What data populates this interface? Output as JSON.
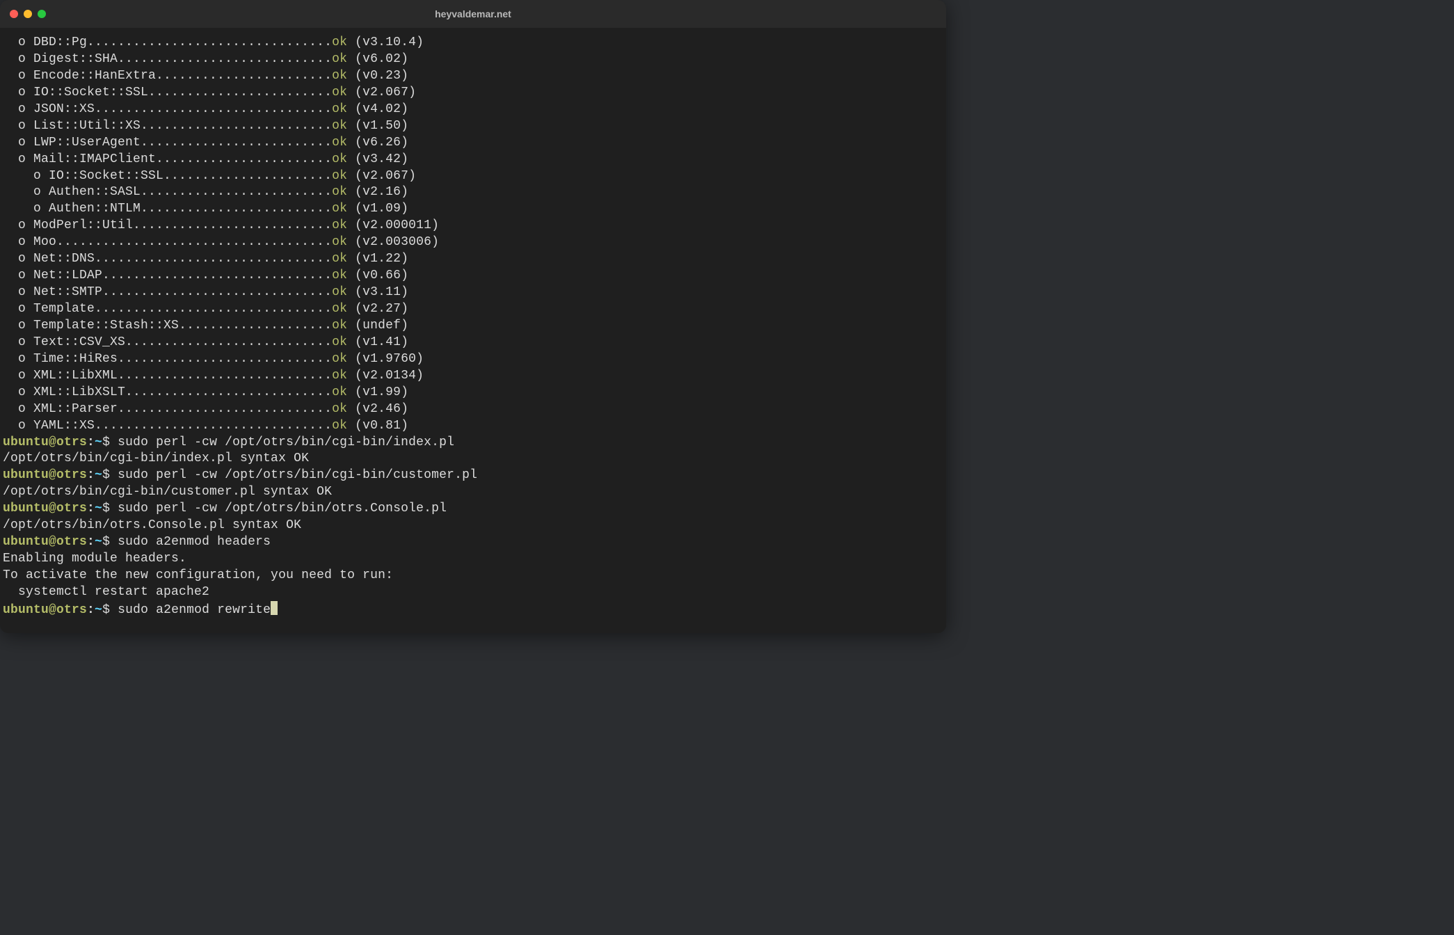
{
  "window": {
    "title": "heyvaldemar.net"
  },
  "layout": {
    "dot_column": 43,
    "indent0": "  ",
    "indent1": "    "
  },
  "modules": [
    {
      "indent": 0,
      "name": "DBD::Pg",
      "status": "ok",
      "version": "(v3.10.4)"
    },
    {
      "indent": 0,
      "name": "Digest::SHA",
      "status": "ok",
      "version": "(v6.02)"
    },
    {
      "indent": 0,
      "name": "Encode::HanExtra",
      "status": "ok",
      "version": "(v0.23)"
    },
    {
      "indent": 0,
      "name": "IO::Socket::SSL",
      "status": "ok",
      "version": "(v2.067)"
    },
    {
      "indent": 0,
      "name": "JSON::XS",
      "status": "ok",
      "version": "(v4.02)"
    },
    {
      "indent": 0,
      "name": "List::Util::XS",
      "status": "ok",
      "version": "(v1.50)"
    },
    {
      "indent": 0,
      "name": "LWP::UserAgent",
      "status": "ok",
      "version": "(v6.26)"
    },
    {
      "indent": 0,
      "name": "Mail::IMAPClient",
      "status": "ok",
      "version": "(v3.42)"
    },
    {
      "indent": 1,
      "name": "IO::Socket::SSL",
      "status": "ok",
      "version": "(v2.067)"
    },
    {
      "indent": 1,
      "name": "Authen::SASL",
      "status": "ok",
      "version": "(v2.16)"
    },
    {
      "indent": 1,
      "name": "Authen::NTLM",
      "status": "ok",
      "version": "(v1.09)"
    },
    {
      "indent": 0,
      "name": "ModPerl::Util",
      "status": "ok",
      "version": "(v2.000011)"
    },
    {
      "indent": 0,
      "name": "Moo",
      "status": "ok",
      "version": "(v2.003006)"
    },
    {
      "indent": 0,
      "name": "Net::DNS",
      "status": "ok",
      "version": "(v1.22)"
    },
    {
      "indent": 0,
      "name": "Net::LDAP",
      "status": "ok",
      "version": "(v0.66)"
    },
    {
      "indent": 0,
      "name": "Net::SMTP",
      "status": "ok",
      "version": "(v3.11)"
    },
    {
      "indent": 0,
      "name": "Template",
      "status": "ok",
      "version": "(v2.27)"
    },
    {
      "indent": 0,
      "name": "Template::Stash::XS",
      "status": "ok",
      "version": "(undef)"
    },
    {
      "indent": 0,
      "name": "Text::CSV_XS",
      "status": "ok",
      "version": "(v1.41)"
    },
    {
      "indent": 0,
      "name": "Time::HiRes",
      "status": "ok",
      "version": "(v1.9760)"
    },
    {
      "indent": 0,
      "name": "XML::LibXML",
      "status": "ok",
      "version": "(v2.0134)"
    },
    {
      "indent": 0,
      "name": "XML::LibXSLT",
      "status": "ok",
      "version": "(v1.99)"
    },
    {
      "indent": 0,
      "name": "XML::Parser",
      "status": "ok",
      "version": "(v2.46)"
    },
    {
      "indent": 0,
      "name": "YAML::XS",
      "status": "ok",
      "version": "(v0.81)"
    }
  ],
  "prompt": {
    "userhost": "ubuntu@otrs",
    "cwd": "~",
    "symbol": "$"
  },
  "tail": [
    {
      "type": "prompt",
      "command": "sudo perl -cw /opt/otrs/bin/cgi-bin/index.pl"
    },
    {
      "type": "output",
      "text": "/opt/otrs/bin/cgi-bin/index.pl syntax OK"
    },
    {
      "type": "prompt",
      "command": "sudo perl -cw /opt/otrs/bin/cgi-bin/customer.pl"
    },
    {
      "type": "output",
      "text": "/opt/otrs/bin/cgi-bin/customer.pl syntax OK"
    },
    {
      "type": "prompt",
      "command": "sudo perl -cw /opt/otrs/bin/otrs.Console.pl"
    },
    {
      "type": "output",
      "text": "/opt/otrs/bin/otrs.Console.pl syntax OK"
    },
    {
      "type": "prompt",
      "command": "sudo a2enmod headers"
    },
    {
      "type": "output",
      "text": "Enabling module headers."
    },
    {
      "type": "output",
      "text": "To activate the new configuration, you need to run:"
    },
    {
      "type": "output",
      "text": "  systemctl restart apache2"
    },
    {
      "type": "prompt",
      "command": "sudo a2enmod rewrite",
      "cursor": true
    }
  ]
}
